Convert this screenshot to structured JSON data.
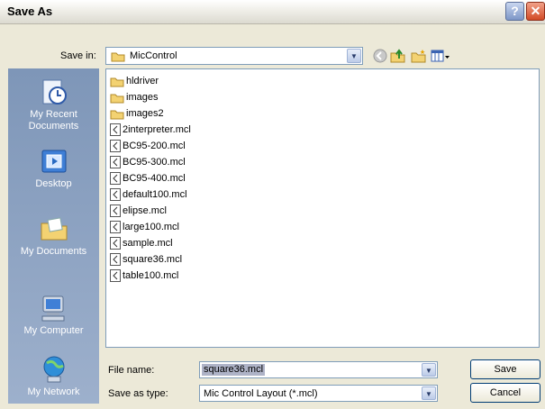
{
  "window": {
    "title": "Save As",
    "help_label": "?",
    "close_label": "✕"
  },
  "save_in": {
    "label": "Save in:",
    "value": "MicControl"
  },
  "places": [
    {
      "label": "My Recent Documents",
      "icon": "recent-documents-icon"
    },
    {
      "label": "Desktop",
      "icon": "desktop-icon"
    },
    {
      "label": "My Documents",
      "icon": "my-documents-icon"
    },
    {
      "label": "My Computer",
      "icon": "my-computer-icon"
    },
    {
      "label": "My Network",
      "icon": "my-network-icon"
    }
  ],
  "files": [
    {
      "name": "hldriver",
      "type": "folder"
    },
    {
      "name": "images",
      "type": "folder"
    },
    {
      "name": "images2",
      "type": "folder"
    },
    {
      "name": "2interpreter.mcl",
      "type": "file"
    },
    {
      "name": "BC95-200.mcl",
      "type": "file"
    },
    {
      "name": "BC95-300.mcl",
      "type": "file"
    },
    {
      "name": "BC95-400.mcl",
      "type": "file"
    },
    {
      "name": "default100.mcl",
      "type": "file"
    },
    {
      "name": "elipse.mcl",
      "type": "file"
    },
    {
      "name": "large100.mcl",
      "type": "file"
    },
    {
      "name": "sample.mcl",
      "type": "file"
    },
    {
      "name": "square36.mcl",
      "type": "file"
    },
    {
      "name": "table100.mcl",
      "type": "file"
    }
  ],
  "file_name": {
    "label": "File name:",
    "value": "square36.mcl"
  },
  "save_type": {
    "label": "Save as type:",
    "value": "Mic Control Layout (*.mcl)"
  },
  "buttons": {
    "save": "Save",
    "cancel": "Cancel"
  }
}
